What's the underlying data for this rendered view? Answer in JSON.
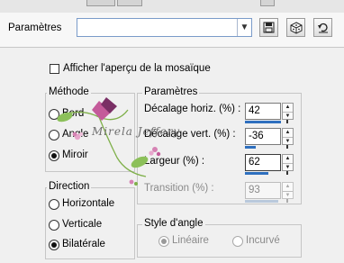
{
  "presets": {
    "label": "Paramètres",
    "value": ""
  },
  "preview_toggle": {
    "label": "Afficher l'aperçu de la mosaïque",
    "checked": false
  },
  "method": {
    "title": "Méthode",
    "options": [
      {
        "label": "Bord",
        "checked": false
      },
      {
        "label": "Angle",
        "checked": false
      },
      {
        "label": "Miroir",
        "checked": true
      }
    ]
  },
  "params": {
    "title": "Paramètres",
    "horizontal_offset": {
      "label": "Décalage horiz. (%) :",
      "value": "42"
    },
    "vertical_offset": {
      "label": "Décalage vert. (%) :",
      "value": "-36"
    },
    "width": {
      "label": "Largeur (%) :",
      "value": "62"
    },
    "transition": {
      "label": "Transition (%) :",
      "value": "93"
    }
  },
  "direction": {
    "title": "Direction",
    "options": [
      {
        "label": "Horizontale",
        "checked": false
      },
      {
        "label": "Verticale",
        "checked": false
      },
      {
        "label": "Bilatérale",
        "checked": true
      }
    ]
  },
  "corner_style": {
    "title": "Style d'angle",
    "options": [
      {
        "label": "Linéaire",
        "checked": true
      },
      {
        "label": "Incurvé",
        "checked": false
      }
    ]
  },
  "watermark": {
    "text": "Mirela Jeffery"
  },
  "icons": [
    "save-icon",
    "dice-icon",
    "reset-icon",
    "chevron-down-icon",
    "flower-decoration"
  ],
  "colors": {
    "accent": "#2e6fbe",
    "border": "#c6c6c6",
    "window_bg": "#f0f0f0",
    "decoration_pink": "#c45a9a",
    "decoration_green": "#7fb04a"
  }
}
